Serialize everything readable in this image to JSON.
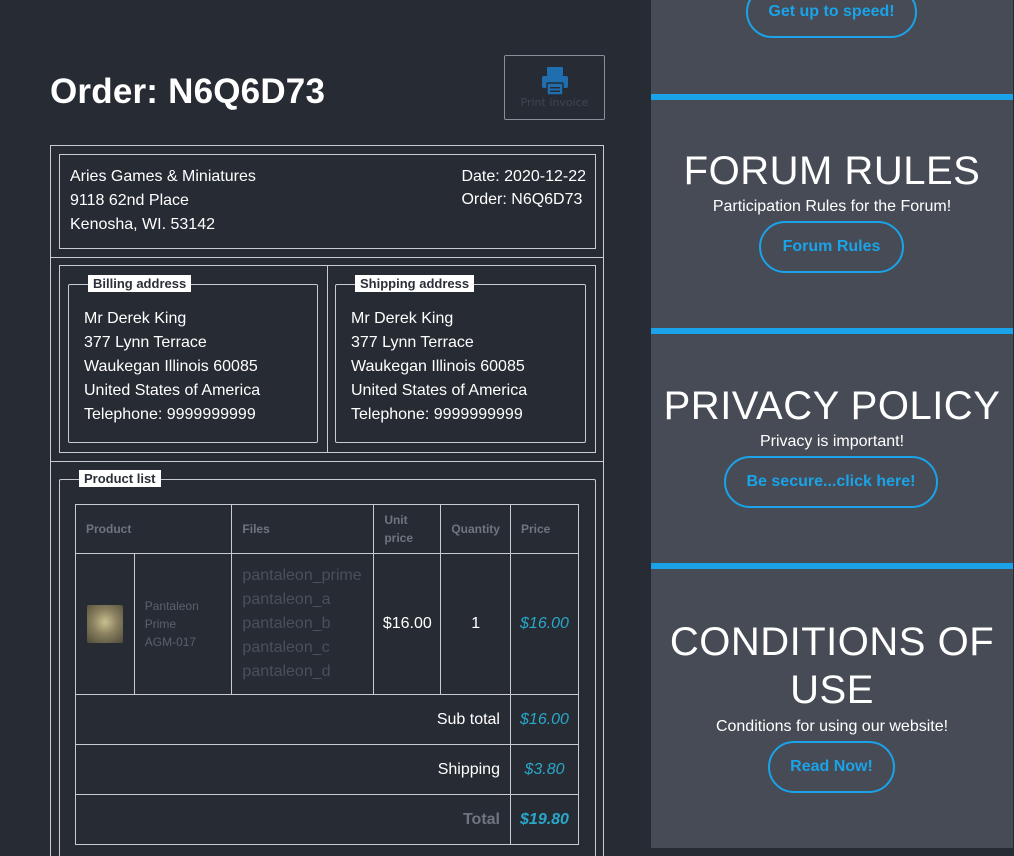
{
  "order": {
    "title": "Order: N6Q6D73",
    "print_label": "Print invoice",
    "shop": {
      "name": "Aries Games & Miniatures",
      "street": "9118 62nd Place",
      "city": "Kenosha, WI. 53142"
    },
    "date_line": "Date: 2020-12-22",
    "order_line": "Order: N6Q6D73",
    "billing": {
      "legend": "Billing address",
      "lines": [
        "Mr Derek King",
        "377 Lynn Terrace",
        "Waukegan Illinois 60085",
        "United States of America",
        "Telephone: 9999999999"
      ]
    },
    "shipping": {
      "legend": "Shipping address",
      "lines": [
        "Mr Derek King",
        "377 Lynn Terrace",
        "Waukegan Illinois 60085",
        "United States of America",
        "Telephone: 9999999999"
      ]
    },
    "products": {
      "legend": "Product list",
      "headers": {
        "product": "Product",
        "files": "Files",
        "unit_price": "Unit price",
        "quantity": "Quantity",
        "price": "Price"
      },
      "rows": [
        {
          "name": "Pantaleon Prime",
          "sku": "AGM-017",
          "files": [
            "pantaleon_prime",
            "pantaleon_a",
            "pantaleon_b",
            "pantaleon_c",
            "pantaleon_d"
          ],
          "unit_price": "$16.00",
          "quantity": "1",
          "price": "$16.00"
        }
      ],
      "subtotal_label": "Sub total",
      "subtotal_value": "$16.00",
      "shipping_label": "Shipping",
      "shipping_value": "$3.80",
      "total_label": "Total",
      "total_value": "$19.80"
    }
  },
  "sidebar": {
    "top_button": "Get up to speed!",
    "forum": {
      "title": "FORUM RULES",
      "subtitle": "Participation Rules for the Forum!",
      "button": "Forum Rules"
    },
    "privacy": {
      "title": "PRIVACY POLICY",
      "subtitle": "Privacy is important!",
      "button": "Be secure...click here!"
    },
    "conditions": {
      "title_line1": "CONDITIONS OF",
      "title_line2": "USE",
      "subtitle": "Conditions for using our website!",
      "button": "Read Now!"
    }
  },
  "colors": {
    "accent": "#1aa3e8",
    "price": "#2aa6c9",
    "background": "#272b33",
    "sidebar": "#474b55"
  }
}
